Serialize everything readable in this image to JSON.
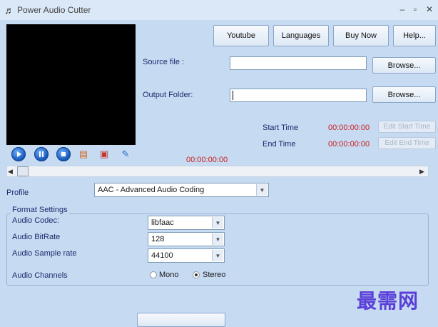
{
  "window": {
    "title": "Power Audio Cutter",
    "icon": "music-note-icon"
  },
  "top_buttons": {
    "youtube": "Youtube",
    "languages": "Languages",
    "buy_now": "Buy Now",
    "help": "Help..."
  },
  "source": {
    "label": "Source file :",
    "value": "",
    "browse": "Browse..."
  },
  "output": {
    "label": "Output Folder:",
    "value": "",
    "browse": "Browse..."
  },
  "times": {
    "start_label": "Start Time",
    "start_value": "00:00:00:00",
    "start_button": "Edit Start Time",
    "end_label": "End Time",
    "end_value": "00:00:00:00",
    "end_button": "Edit End Time",
    "position": "00:00:00:00"
  },
  "player_icons": [
    "play-icon",
    "pause-icon",
    "stop-icon",
    "mark-start-icon",
    "mark-end-icon",
    "clear-icon"
  ],
  "profile": {
    "label": "Profile",
    "value": "AAC - Advanced Audio Coding"
  },
  "format": {
    "legend": "Format Settings",
    "codec_label": "Audio Codec:",
    "codec_value": "libfaac",
    "bitrate_label": "Audio BitRate",
    "bitrate_value": "128",
    "samplerate_label": "Audio Sample rate",
    "samplerate_value": "44100",
    "channels_label": "Audio Channels",
    "mono": "Mono",
    "stereo": "Stereo",
    "selected_channel": "Stereo"
  },
  "watermark": "最需网",
  "colors": {
    "time_red": "#cc1f1f",
    "background": "#c6daf2",
    "label_blue": "#1a2b6b"
  }
}
